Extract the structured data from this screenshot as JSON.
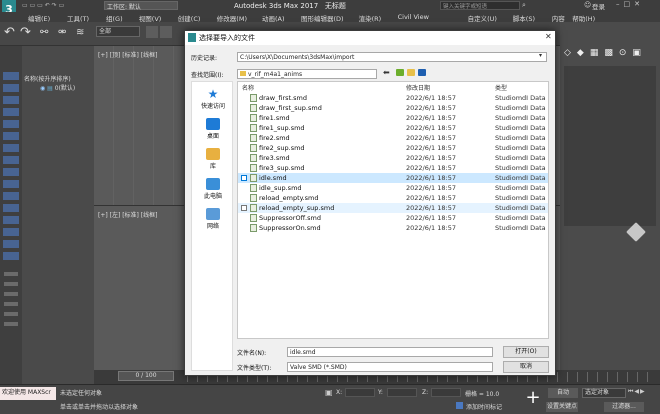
{
  "app": {
    "window_title": "Autodesk 3ds Max 2017",
    "file_title": "无标题",
    "workspace": "工作区: 默认",
    "search_placeholder": "键入关键字或短语",
    "login": "登录"
  },
  "menu": [
    "编辑(E)",
    "工具(T)",
    "组(G)",
    "视图(V)",
    "创建(C)",
    "修改器(M)",
    "动画(A)",
    "图形编辑器(D)",
    "渲染(R)",
    "Civil View",
    "自定义(U)",
    "脚本(S)",
    "内容",
    "帮助(H)"
  ],
  "toolbar": {
    "filter_value": "全部",
    "scene_tabs": [
      "选择",
      "显示",
      "编辑"
    ]
  },
  "scene_explorer": {
    "column_header": "名称(按升序排序)",
    "root_item": "0(默认)"
  },
  "viewports": {
    "top_left_label": "[+] [顶] [标准] [线框]",
    "bottom_left_label": "[+] [左] [标准] [线框]"
  },
  "dialog": {
    "title": "选择要导入的文件",
    "history_label": "历史记录:",
    "history_value": "C:\\Users\\X\\Documents\\3dsMax\\import",
    "lookin_label": "查找范围(I):",
    "lookin_value": "v_rif_m4a1_anims",
    "places": [
      "快速访问",
      "桌面",
      "库",
      "此电脑",
      "网络"
    ],
    "columns": {
      "name": "名称",
      "date": "修改日期",
      "type": "类型"
    },
    "files": [
      {
        "name": "draw_first.smd",
        "date": "2022/6/1 18:57",
        "type": "StudiomdI Data",
        "state": ""
      },
      {
        "name": "draw_first_sup.smd",
        "date": "2022/6/1 18:57",
        "type": "StudiomdI Data",
        "state": ""
      },
      {
        "name": "fire1.smd",
        "date": "2022/6/1 18:57",
        "type": "StudiomdI Data",
        "state": ""
      },
      {
        "name": "fire1_sup.smd",
        "date": "2022/6/1 18:57",
        "type": "StudiomdI Data",
        "state": ""
      },
      {
        "name": "fire2.smd",
        "date": "2022/6/1 18:57",
        "type": "StudiomdI Data",
        "state": ""
      },
      {
        "name": "fire2_sup.smd",
        "date": "2022/6/1 18:57",
        "type": "StudiomdI Data",
        "state": ""
      },
      {
        "name": "fire3.smd",
        "date": "2022/6/1 18:57",
        "type": "StudiomdI Data",
        "state": ""
      },
      {
        "name": "fire3_sup.smd",
        "date": "2022/6/1 18:57",
        "type": "StudiomdI Data",
        "state": ""
      },
      {
        "name": "idle.smd",
        "date": "2022/6/1 18:57",
        "type": "StudiomdI Data",
        "state": "selected"
      },
      {
        "name": "idle_sup.smd",
        "date": "2022/6/1 18:57",
        "type": "StudiomdI Data",
        "state": ""
      },
      {
        "name": "reload_empty.smd",
        "date": "2022/6/1 18:57",
        "type": "StudiomdI Data",
        "state": ""
      },
      {
        "name": "reload_empty_sup.smd",
        "date": "2022/6/1 18:57",
        "type": "StudiomdI Data",
        "state": "hover"
      },
      {
        "name": "SuppressorOff.smd",
        "date": "2022/6/1 18:57",
        "type": "StudiomdI Data",
        "state": ""
      },
      {
        "name": "SuppressorOn.smd",
        "date": "2022/6/1 18:57",
        "type": "StudiomdI Data",
        "state": ""
      }
    ],
    "filename_label": "文件名(N):",
    "filename_value": "idle.smd",
    "filetype_label": "文件类型(T):",
    "filetype_value": "Valve SMD (*.SMD)",
    "open_button": "打开(O)",
    "cancel_button": "取消"
  },
  "timeline": {
    "frame": "0 / 100"
  },
  "status": {
    "script_prompt": "欢迎使用 MAXScr",
    "line1": "未选定任何对象",
    "line2": "单击或单击并拖动以选择对象",
    "x_label": "X:",
    "y_label": "Y:",
    "z_label": "Z:",
    "grid": "栅格 = 10.0",
    "add_time_tag": "添加时间标记",
    "auto_key": "自动",
    "set_key": "设置关键点",
    "selection_dropdown": "选定对象",
    "filter": "过滤器..."
  },
  "colors": {
    "app_bg": "#444444",
    "dialog_bg": "#f0f0f0",
    "selection": "#cce8ff",
    "folder": "#e8c04a",
    "accent": "#0078d7"
  }
}
